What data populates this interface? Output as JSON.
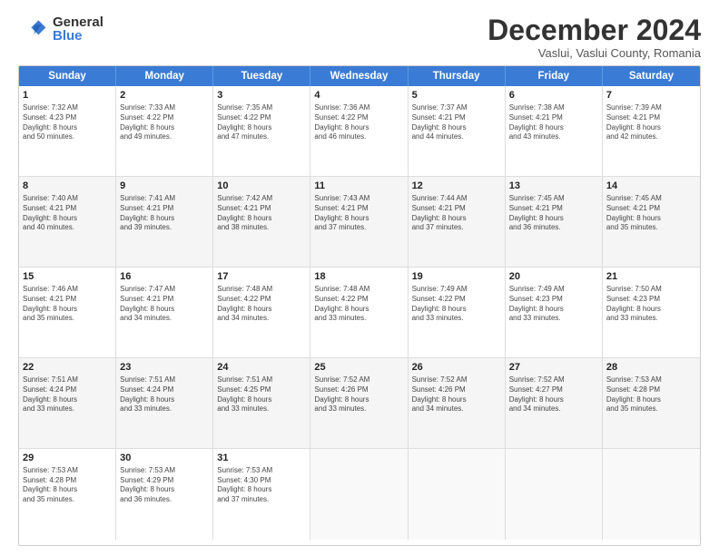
{
  "logo": {
    "general": "General",
    "blue": "Blue"
  },
  "header": {
    "month": "December 2024",
    "location": "Vaslui, Vaslui County, Romania"
  },
  "days": [
    "Sunday",
    "Monday",
    "Tuesday",
    "Wednesday",
    "Thursday",
    "Friday",
    "Saturday"
  ],
  "weeks": [
    [
      {
        "num": "1",
        "lines": [
          "Sunrise: 7:32 AM",
          "Sunset: 4:23 PM",
          "Daylight: 8 hours",
          "and 50 minutes."
        ]
      },
      {
        "num": "2",
        "lines": [
          "Sunrise: 7:33 AM",
          "Sunset: 4:22 PM",
          "Daylight: 8 hours",
          "and 49 minutes."
        ]
      },
      {
        "num": "3",
        "lines": [
          "Sunrise: 7:35 AM",
          "Sunset: 4:22 PM",
          "Daylight: 8 hours",
          "and 47 minutes."
        ]
      },
      {
        "num": "4",
        "lines": [
          "Sunrise: 7:36 AM",
          "Sunset: 4:22 PM",
          "Daylight: 8 hours",
          "and 46 minutes."
        ]
      },
      {
        "num": "5",
        "lines": [
          "Sunrise: 7:37 AM",
          "Sunset: 4:21 PM",
          "Daylight: 8 hours",
          "and 44 minutes."
        ]
      },
      {
        "num": "6",
        "lines": [
          "Sunrise: 7:38 AM",
          "Sunset: 4:21 PM",
          "Daylight: 8 hours",
          "and 43 minutes."
        ]
      },
      {
        "num": "7",
        "lines": [
          "Sunrise: 7:39 AM",
          "Sunset: 4:21 PM",
          "Daylight: 8 hours",
          "and 42 minutes."
        ]
      }
    ],
    [
      {
        "num": "8",
        "lines": [
          "Sunrise: 7:40 AM",
          "Sunset: 4:21 PM",
          "Daylight: 8 hours",
          "and 40 minutes."
        ]
      },
      {
        "num": "9",
        "lines": [
          "Sunrise: 7:41 AM",
          "Sunset: 4:21 PM",
          "Daylight: 8 hours",
          "and 39 minutes."
        ]
      },
      {
        "num": "10",
        "lines": [
          "Sunrise: 7:42 AM",
          "Sunset: 4:21 PM",
          "Daylight: 8 hours",
          "and 38 minutes."
        ]
      },
      {
        "num": "11",
        "lines": [
          "Sunrise: 7:43 AM",
          "Sunset: 4:21 PM",
          "Daylight: 8 hours",
          "and 37 minutes."
        ]
      },
      {
        "num": "12",
        "lines": [
          "Sunrise: 7:44 AM",
          "Sunset: 4:21 PM",
          "Daylight: 8 hours",
          "and 37 minutes."
        ]
      },
      {
        "num": "13",
        "lines": [
          "Sunrise: 7:45 AM",
          "Sunset: 4:21 PM",
          "Daylight: 8 hours",
          "and 36 minutes."
        ]
      },
      {
        "num": "14",
        "lines": [
          "Sunrise: 7:45 AM",
          "Sunset: 4:21 PM",
          "Daylight: 8 hours",
          "and 35 minutes."
        ]
      }
    ],
    [
      {
        "num": "15",
        "lines": [
          "Sunrise: 7:46 AM",
          "Sunset: 4:21 PM",
          "Daylight: 8 hours",
          "and 35 minutes."
        ]
      },
      {
        "num": "16",
        "lines": [
          "Sunrise: 7:47 AM",
          "Sunset: 4:21 PM",
          "Daylight: 8 hours",
          "and 34 minutes."
        ]
      },
      {
        "num": "17",
        "lines": [
          "Sunrise: 7:48 AM",
          "Sunset: 4:22 PM",
          "Daylight: 8 hours",
          "and 34 minutes."
        ]
      },
      {
        "num": "18",
        "lines": [
          "Sunrise: 7:48 AM",
          "Sunset: 4:22 PM",
          "Daylight: 8 hours",
          "and 33 minutes."
        ]
      },
      {
        "num": "19",
        "lines": [
          "Sunrise: 7:49 AM",
          "Sunset: 4:22 PM",
          "Daylight: 8 hours",
          "and 33 minutes."
        ]
      },
      {
        "num": "20",
        "lines": [
          "Sunrise: 7:49 AM",
          "Sunset: 4:23 PM",
          "Daylight: 8 hours",
          "and 33 minutes."
        ]
      },
      {
        "num": "21",
        "lines": [
          "Sunrise: 7:50 AM",
          "Sunset: 4:23 PM",
          "Daylight: 8 hours",
          "and 33 minutes."
        ]
      }
    ],
    [
      {
        "num": "22",
        "lines": [
          "Sunrise: 7:51 AM",
          "Sunset: 4:24 PM",
          "Daylight: 8 hours",
          "and 33 minutes."
        ]
      },
      {
        "num": "23",
        "lines": [
          "Sunrise: 7:51 AM",
          "Sunset: 4:24 PM",
          "Daylight: 8 hours",
          "and 33 minutes."
        ]
      },
      {
        "num": "24",
        "lines": [
          "Sunrise: 7:51 AM",
          "Sunset: 4:25 PM",
          "Daylight: 8 hours",
          "and 33 minutes."
        ]
      },
      {
        "num": "25",
        "lines": [
          "Sunrise: 7:52 AM",
          "Sunset: 4:26 PM",
          "Daylight: 8 hours",
          "and 33 minutes."
        ]
      },
      {
        "num": "26",
        "lines": [
          "Sunrise: 7:52 AM",
          "Sunset: 4:26 PM",
          "Daylight: 8 hours",
          "and 34 minutes."
        ]
      },
      {
        "num": "27",
        "lines": [
          "Sunrise: 7:52 AM",
          "Sunset: 4:27 PM",
          "Daylight: 8 hours",
          "and 34 minutes."
        ]
      },
      {
        "num": "28",
        "lines": [
          "Sunrise: 7:53 AM",
          "Sunset: 4:28 PM",
          "Daylight: 8 hours",
          "and 35 minutes."
        ]
      }
    ],
    [
      {
        "num": "29",
        "lines": [
          "Sunrise: 7:53 AM",
          "Sunset: 4:28 PM",
          "Daylight: 8 hours",
          "and 35 minutes."
        ]
      },
      {
        "num": "30",
        "lines": [
          "Sunrise: 7:53 AM",
          "Sunset: 4:29 PM",
          "Daylight: 8 hours",
          "and 36 minutes."
        ]
      },
      {
        "num": "31",
        "lines": [
          "Sunrise: 7:53 AM",
          "Sunset: 4:30 PM",
          "Daylight: 8 hours",
          "and 37 minutes."
        ]
      },
      {
        "num": "",
        "lines": []
      },
      {
        "num": "",
        "lines": []
      },
      {
        "num": "",
        "lines": []
      },
      {
        "num": "",
        "lines": []
      }
    ]
  ]
}
